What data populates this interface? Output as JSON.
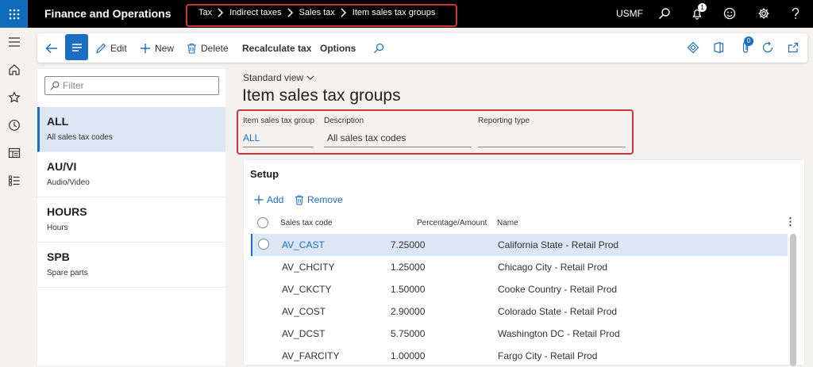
{
  "app": {
    "title": "Finance and Operations",
    "company": "USMF",
    "notification_count": "1"
  },
  "breadcrumb": [
    "Tax",
    "Indirect taxes",
    "Sales tax",
    "Item sales tax groups"
  ],
  "actions": {
    "edit": "Edit",
    "new": "New",
    "delete": "Delete",
    "recalculate": "Recalculate tax",
    "options": "Options",
    "badge": "0"
  },
  "list": {
    "filter_placeholder": "Filter",
    "items": [
      {
        "title": "ALL",
        "subtitle": "All sales tax codes"
      },
      {
        "title": "AU/VI",
        "subtitle": "Audio/Video"
      },
      {
        "title": "HOURS",
        "subtitle": "Hours"
      },
      {
        "title": "SPB",
        "subtitle": "Spare parts"
      }
    ]
  },
  "page": {
    "view": "Standard view",
    "title": "Item sales tax groups"
  },
  "fields": {
    "group_label": "Item sales tax group",
    "group_value": "ALL",
    "desc_label": "Description",
    "desc_value": "All sales tax codes",
    "reporting_label": "Reporting type",
    "reporting_value": ""
  },
  "setup": {
    "title": "Setup",
    "add": "Add",
    "remove": "Remove",
    "columns": [
      "Sales tax code",
      "Percentage/Amount",
      "Name"
    ],
    "rows": [
      {
        "code": "AV_CAST",
        "pct": "7.25000",
        "name": "California State - Retail Prod"
      },
      {
        "code": "AV_CHCITY",
        "pct": "1.25000",
        "name": "Chicago City - Retail Prod"
      },
      {
        "code": "AV_CKCTY",
        "pct": "1.50000",
        "name": "Cooke Country - Retail Prod"
      },
      {
        "code": "AV_COST",
        "pct": "2.90000",
        "name": "Colorado State - Retail Prod"
      },
      {
        "code": "AV_DCST",
        "pct": "5.75000",
        "name": "Washington DC - Retail Prod"
      },
      {
        "code": "AV_FARCITY",
        "pct": "1.00000",
        "name": "Fargo City - Retail Prod"
      }
    ]
  },
  "colors": {
    "accent": "#1b6ec2",
    "highlight": "#d13438",
    "selected_row": "#dce6f4"
  }
}
